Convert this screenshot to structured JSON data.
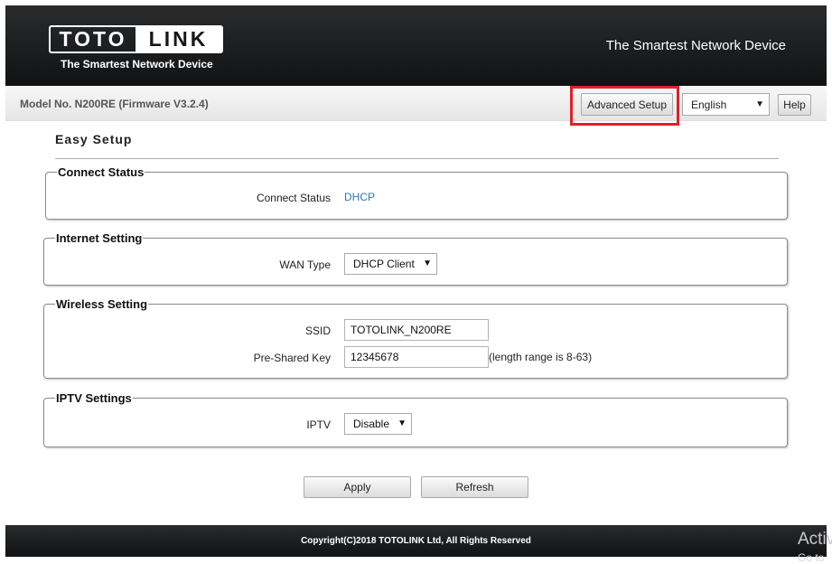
{
  "header": {
    "logo_left": "TOTO",
    "logo_right": "LINK",
    "logo_sub": "The Smartest Network Device",
    "slogan": "The Smartest Network Device"
  },
  "bar": {
    "model": "Model No. N200RE (Firmware V3.2.4)",
    "advanced_label": "Advanced Setup",
    "language": "English",
    "help_label": "Help",
    "highlight_color": "#e0202a"
  },
  "page": {
    "title": "Easy Setup"
  },
  "connect_status": {
    "legend": "Connect Status",
    "label": "Connect Status",
    "value": "DHCP"
  },
  "internet": {
    "legend": "Internet Setting",
    "wan_label": "WAN Type",
    "wan_value": "DHCP Client"
  },
  "wireless": {
    "legend": "Wireless Setting",
    "ssid_label": "SSID",
    "ssid_value": "TOTOLINK_N200RE",
    "psk_label": "Pre-Shared Key",
    "psk_value": "12345678",
    "psk_hint": "(length range is 8-63)"
  },
  "iptv": {
    "legend": "IPTV Settings",
    "label": "IPTV",
    "value": "Disable"
  },
  "actions": {
    "apply": "Apply",
    "refresh": "Refresh"
  },
  "footer": {
    "copyright": "Copyright(C)2018 TOTOLINK Ltd, All Rights Reserved"
  },
  "overlay": {
    "watermark": "Activ",
    "watermark_sub": "Go to"
  }
}
